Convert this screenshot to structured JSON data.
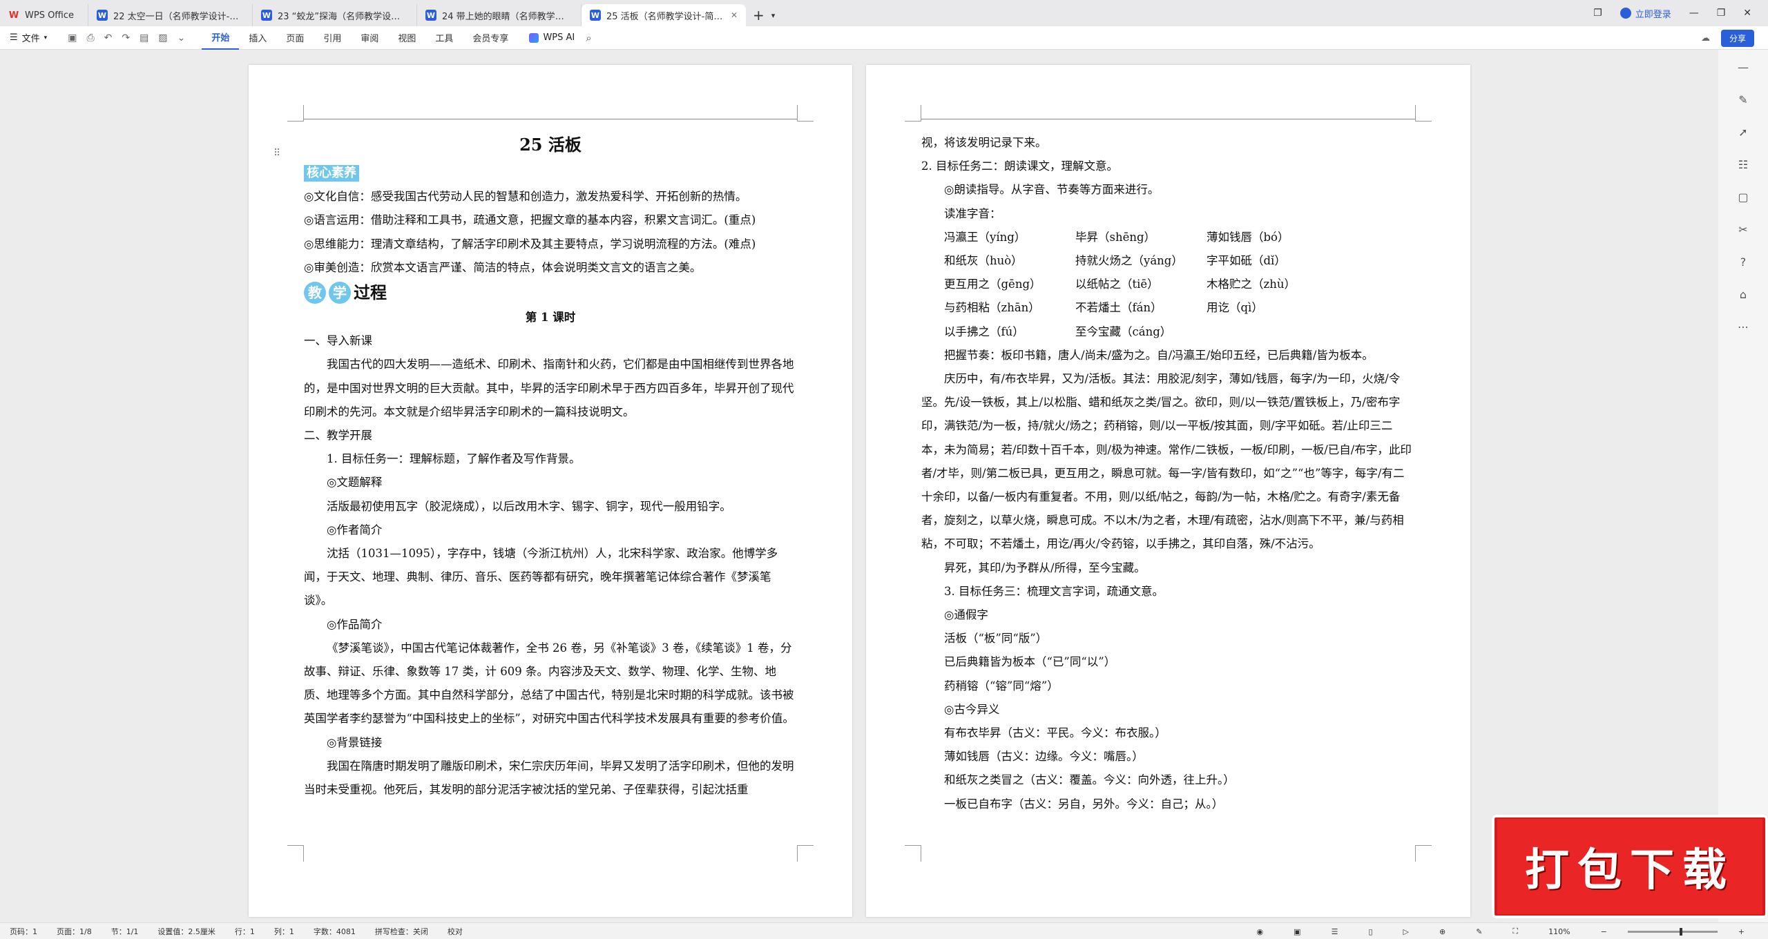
{
  "tabs": [
    {
      "label": "WPS Office",
      "icon": "wps-logo-icon",
      "active": false
    },
    {
      "label": "22 太空一日（名师教学设计-简案）-2",
      "icon": "word-doc-icon",
      "active": false
    },
    {
      "label": "23 “蛟龙”探海（名师教学设计-简案）",
      "icon": "word-doc-icon",
      "active": false
    },
    {
      "label": "24 带上她的眼睛（名师教学设计-简案）",
      "icon": "word-doc-icon",
      "active": false
    },
    {
      "label": "25 活板（名师教学设计-简案）",
      "icon": "word-doc-icon",
      "active": true
    }
  ],
  "window": {
    "login": "立即登录"
  },
  "toolbar": {
    "file": "文件",
    "ribbon": [
      "开始",
      "插入",
      "页面",
      "引用",
      "审阅",
      "视图",
      "工具",
      "会员专享"
    ],
    "wps_ai": "WPS AI",
    "share": "分享"
  },
  "page1": {
    "title": "25  活板",
    "core_badge": "核心素养",
    "core_items": [
      "◎文化自信：感受我国古代劳动人民的智慧和创造力，激发热爱科学、开拓创新的热情。",
      "◎语言运用：借助注释和工具书，疏通文意，把握文章的基本内容，积累文言词汇。(重点)",
      "◎思维能力：理清文章结构，了解活字印刷术及其主要特点，学习说明流程的方法。(难点)",
      "◎审美创造：欣赏本文语言严谨、简洁的特点，体会说明类文言文的语言之美。"
    ],
    "jx_c1": "教",
    "jx_c2": "学",
    "jx_rest": "过程",
    "lesson": "第 1 课时",
    "s1": "一、导入新课",
    "p_intro": "我国古代的四大发明——造纸术、印刷术、指南针和火药，它们都是由中国相继传到世界各地的，是中国对世界文明的巨大贡献。其中，毕昇的活字印刷术早于西方四百多年，毕昇开创了现代印刷术的先河。本文就是介绍毕昇活字印刷术的一篇科技说明文。",
    "s2": "二、教学开展",
    "task1": "1. 目标任务一：理解标题，了解作者及写作背景。",
    "tj_h": "◎文题解释",
    "tj_p": "活版最初使用瓦字（胶泥烧成），以后改用木字、锡字、铜字，现代一般用铅字。",
    "zz_h": "◎作者简介",
    "zz_p": "沈括（1031—1095），字存中，钱塘（今浙江杭州）人，北宋科学家、政治家。他博学多闻，于天文、地理、典制、律历、音乐、医药等都有研究，晚年撰著笔记体综合著作《梦溪笔谈》。",
    "zp_h": "◎作品简介",
    "zp_p": "《梦溪笔谈》，中国古代笔记体裁著作，全书 26 卷，另《补笔谈》3 卷，《续笔谈》1 卷，分故事、辩证、乐律、象数等 17 类，计 609 条。内容涉及天文、数学、物理、化学、生物、地质、地理等多个方面。其中自然科学部分，总结了中国古代，特别是北宋时期的科学成就。该书被英国学者李约瑟誉为“中国科技史上的坐标”，对研究中国古代科学技术发展具有重要的参考价值。",
    "bj_h": "◎背景链接",
    "bj_p": "我国在隋唐时期发明了雕版印刷术，宋仁宗庆历年间，毕昇又发明了活字印刷术，但他的发明当时未受重视。他死后，其发明的部分泥活字被沈括的堂兄弟、子侄辈获得，引起沈括重"
  },
  "page2": {
    "cont": "视，将该发明记录下来。",
    "task2": "2. 目标任务二：朗读课文，理解文意。",
    "ld_h": "◎朗读指导。从字音、节奏等方面来进行。",
    "dz_h": "读准字音：",
    "readings": [
      [
        "冯瀛王（yíng）",
        "毕昇（shēng）",
        "薄如钱唇（bó）"
      ],
      [
        "和纸灰（huò）",
        "持就火炀之（yáng）",
        "字平如砥（dǐ）"
      ],
      [
        "更互用之（gēng）",
        "以纸帖之（tiē）",
        "木格贮之（zhù）"
      ],
      [
        "与药相粘（zhān）",
        "不若燔土（fán）",
        "用讫（qì）"
      ],
      [
        "以手拂之（fú）",
        "至今宝藏（cáng）",
        ""
      ]
    ],
    "jz_p": "把握节奏：板印书籍，唐人/尚未/盛为之。自/冯瀛王/始印五经，已后典籍/皆为板本。",
    "p_text": "庆历中，有/布衣毕昇，又为/活板。其法：用胶泥/刻字，薄如/钱唇，每字/为一印，火烧/令坚。先/设一铁板，其上/以松脂、蜡和纸灰之类/冒之。欲印，则/以一铁范/置铁板上，乃/密布字印，满铁范/为一板，持/就火/炀之；药稍镕，则/以一平板/按其面，则/字平如砥。若/止印三二本，未为简易；若/印数十百千本，则/极为神速。常作/二铁板，一板/印刷，一板/已自/布字，此印者/才毕，则/第二板已具，更互用之，瞬息可就。每一字/皆有数印，如“之”“也”等字，每字/有二十余印，以备/一板内有重复者。不用，则/以纸/帖之，每韵/为一帖，木格/贮之。有奇字/素无备者，旋刻之，以草火烧，瞬息可成。不以木/为之者，木理/有疏密，沾水/则高下不平，兼/与药相粘，不可取；不若燔土，用讫/再火/令药镕，以手拂之，其印自落，殊/不沾污。",
    "p_end": "昇死，其印/为予群从/所得，至今宝藏。",
    "task3": "3. 目标任务三：梳理文言字词，疏通文意。",
    "tj2_h": "◎通假字",
    "tj2_items": [
      "活板（“板”同“版”）",
      "已后典籍皆为板本（“已”同“以”）",
      "药稍镕（“镕”同“熔”）"
    ],
    "gj_h": "◎古今异义",
    "gj_items": [
      "有布衣毕昇（古义：平民。今义：布衣服。）",
      "薄如钱唇（古义：边缘。今义：嘴唇。）",
      "和纸灰之类冒之（古义：覆盖。今义：向外透，往上升。）",
      "一板已自布字（古义：另自，另外。今义：自己；从。）"
    ]
  },
  "banner": "打包下载",
  "status": {
    "page_no": "页码：1",
    "pages": "页面：1/8",
    "section": "节：1/1",
    "setting": "设置值：2.5厘米",
    "row": "行：1",
    "col": "列：1",
    "words": "字数：4081",
    "spell": "拼写检查：关闭",
    "proof": "校对",
    "zoom": "110%"
  }
}
